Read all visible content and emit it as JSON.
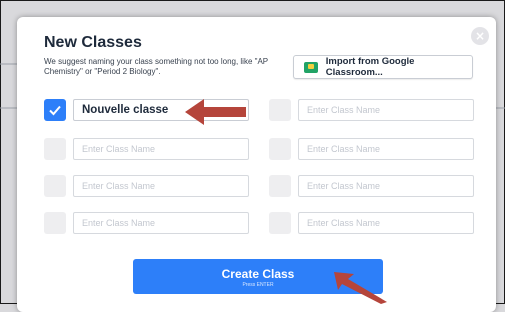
{
  "modal": {
    "title": "New Classes",
    "subtitle": "We suggest naming your class something not too long, like \"AP Chemistry\" or \"Period 2 Biology\".",
    "import_label": "Import from Google Classroom...",
    "close_glyph": "×"
  },
  "rows": [
    {
      "left": {
        "checked": true,
        "value": "Nouvelle classe",
        "placeholder": "Enter Class Name"
      },
      "right": {
        "checked": false,
        "value": "",
        "placeholder": "Enter Class Name"
      }
    },
    {
      "left": {
        "checked": false,
        "value": "",
        "placeholder": "Enter Class Name"
      },
      "right": {
        "checked": false,
        "value": "",
        "placeholder": "Enter Class Name"
      }
    },
    {
      "left": {
        "checked": false,
        "value": "",
        "placeholder": "Enter Class Name"
      },
      "right": {
        "checked": false,
        "value": "",
        "placeholder": "Enter Class Name"
      }
    },
    {
      "left": {
        "checked": false,
        "value": "",
        "placeholder": "Enter Class Name"
      },
      "right": {
        "checked": false,
        "value": "",
        "placeholder": "Enter Class Name"
      }
    }
  ],
  "create": {
    "label": "Create Class",
    "hint": "Press ENTER"
  },
  "colors": {
    "accent": "#2d7ff9",
    "annotation_arrow": "#b5453b"
  },
  "icons": {
    "close": "close-icon",
    "import": "google-classroom-icon",
    "check": "check-icon"
  }
}
